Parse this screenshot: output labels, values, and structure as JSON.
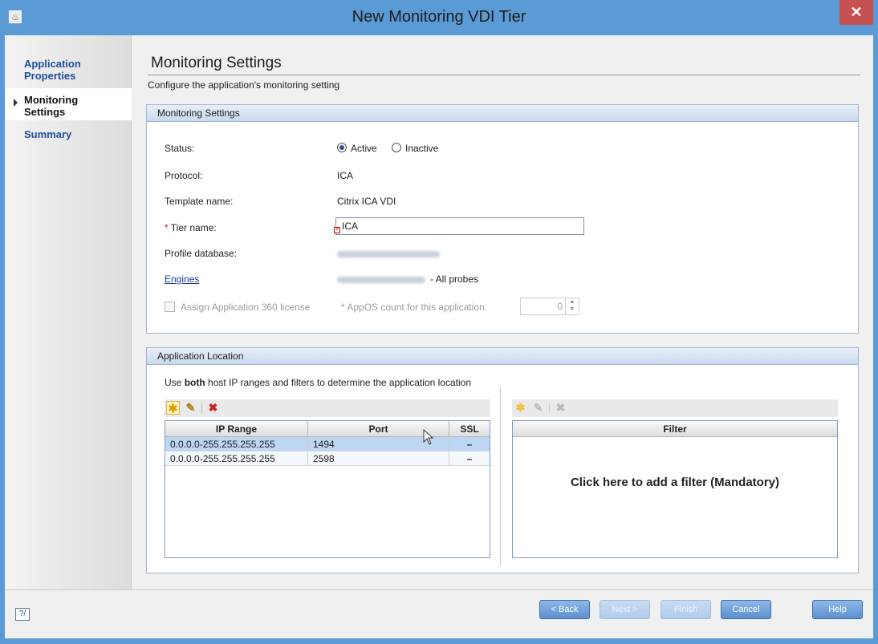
{
  "window": {
    "title": "New Monitoring VDI Tier",
    "close_glyph": "✕",
    "app_icon": "java-cup-icon"
  },
  "nav": {
    "items": [
      {
        "label_line1": "Application",
        "label_line2": "Properties"
      },
      {
        "label_line1": "Monitoring",
        "label_line2": "Settings"
      },
      {
        "label_line1": "Summary",
        "label_line2": ""
      }
    ],
    "active_index": 1
  },
  "page": {
    "heading": "Monitoring Settings",
    "subtitle": "Configure the application's monitoring setting"
  },
  "monitoring": {
    "panel_title": "Monitoring Settings",
    "status_label": "Status:",
    "status_options": [
      "Active",
      "Inactive"
    ],
    "status_selected": "Active",
    "protocol_label": "Protocol:",
    "protocol_value": "ICA",
    "template_label": "Template name:",
    "template_value": "Citrix ICA VDI",
    "required_mark": "*",
    "tier_label": "Tier name:",
    "tier_value": "ICA",
    "profile_label": "Profile database:",
    "engines_label": "Engines",
    "engines_suffix": "- All probes",
    "license_label": "Assign Application 360 license",
    "appos_label": "* AppOS count for this application:",
    "appos_value": "0"
  },
  "location": {
    "panel_title": "Application Location",
    "instruction_prefix": "Use ",
    "instruction_bold": "both",
    "instruction_suffix": " host IP ranges and filters to determine the application location",
    "ip_table": {
      "columns": [
        "IP Range",
        "Port",
        "SSL"
      ],
      "rows": [
        {
          "ip": "0.0.0.0-255.255.255.255",
          "port": "1494",
          "ssl": "–"
        },
        {
          "ip": "0.0.0.0-255.255.255.255",
          "port": "2598",
          "ssl": "–"
        }
      ],
      "selected_row": 0
    },
    "filter_table": {
      "column": "Filter",
      "placeholder": "Click here to add a filter (Mandatory)"
    }
  },
  "footer": {
    "back": "< Back",
    "next": "Next >",
    "finish": "Finish",
    "cancel": "Cancel",
    "help": "Help"
  },
  "colors": {
    "titlebar": "#5b9bd5",
    "close": "#c75050",
    "link": "#1a3c9c",
    "selection": "#bcd6f3"
  }
}
